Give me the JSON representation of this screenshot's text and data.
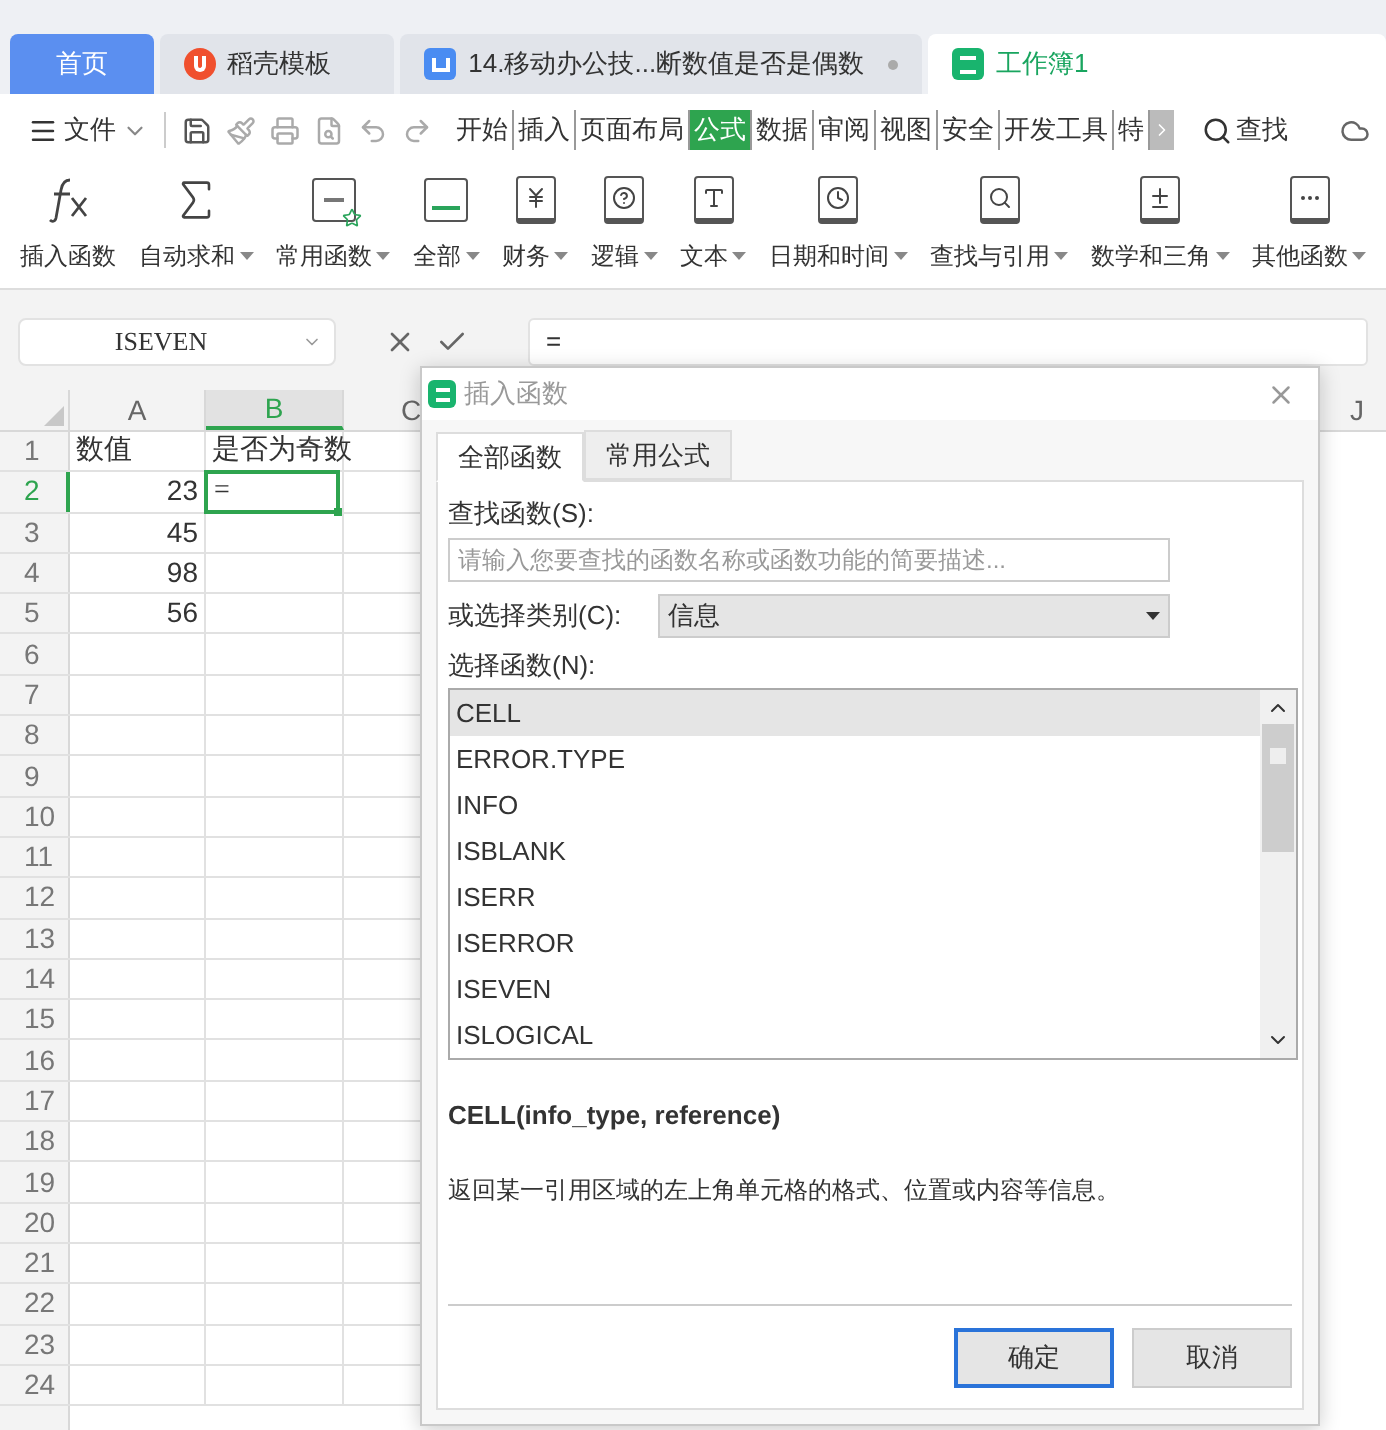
{
  "tabs": [
    {
      "label": "首页",
      "kind": "home",
      "selected": false,
      "modified": false
    },
    {
      "label": "稻壳模板",
      "kind": "docer",
      "selected": false,
      "modified": false
    },
    {
      "label": "14.移动办公技...断数值是否是偶数",
      "kind": "writer",
      "selected": false,
      "modified": true
    },
    {
      "label": "工作簿1",
      "kind": "sheet",
      "selected": true,
      "modified": false
    }
  ],
  "toolbar": {
    "file_menu": "文件",
    "menu_tabs": [
      {
        "label": "开始",
        "selected": false
      },
      {
        "label": "插入",
        "selected": false
      },
      {
        "label": "页面布局",
        "selected": false
      },
      {
        "label": "公式",
        "selected": true
      },
      {
        "label": "数据",
        "selected": false
      },
      {
        "label": "审阅",
        "selected": false
      },
      {
        "label": "视图",
        "selected": false
      },
      {
        "label": "安全",
        "selected": false
      },
      {
        "label": "开发工具",
        "selected": false
      },
      {
        "label": "特",
        "selected": false
      }
    ],
    "search": "查找"
  },
  "ribbon": [
    {
      "label": "插入函数",
      "has_menu": false
    },
    {
      "label": "自动求和",
      "has_menu": true
    },
    {
      "label": "常用函数",
      "has_menu": true
    },
    {
      "label": "全部",
      "has_menu": true
    },
    {
      "label": "财务",
      "has_menu": true
    },
    {
      "label": "逻辑",
      "has_menu": true
    },
    {
      "label": "文本",
      "has_menu": true
    },
    {
      "label": "日期和时间",
      "has_menu": true
    },
    {
      "label": "查找与引用",
      "has_menu": true
    },
    {
      "label": "数学和三角",
      "has_menu": true
    },
    {
      "label": "其他函数",
      "has_menu": true
    }
  ],
  "formula_bar": {
    "name_box": "ISEVEN",
    "formula": "="
  },
  "sheet": {
    "columns": [
      {
        "label": "A",
        "selected": false
      },
      {
        "label": "B",
        "selected": true
      },
      {
        "label": "C",
        "selected": false
      },
      {
        "label": "J",
        "selected": false
      }
    ],
    "rows": [
      {
        "header": "1",
        "selected": false,
        "cells": [
          {
            "value": "数值",
            "kind": "text",
            "active": false
          },
          {
            "value": "是否为奇数",
            "kind": "text",
            "active": false
          }
        ]
      },
      {
        "header": "2",
        "selected": true,
        "cells": [
          {
            "value": "23",
            "kind": "number",
            "active": false
          },
          {
            "value": "=",
            "kind": "text",
            "active": true
          }
        ]
      },
      {
        "header": "3",
        "selected": false,
        "cells": [
          {
            "value": "45",
            "kind": "number",
            "active": false
          }
        ]
      },
      {
        "header": "4",
        "selected": false,
        "cells": [
          {
            "value": "98",
            "kind": "number",
            "active": false
          }
        ]
      },
      {
        "header": "5",
        "selected": false,
        "cells": [
          {
            "value": "56",
            "kind": "number",
            "active": false
          }
        ]
      },
      {
        "header": "6",
        "selected": false
      },
      {
        "header": "7",
        "selected": false
      },
      {
        "header": "8",
        "selected": false
      },
      {
        "header": "9",
        "selected": false
      },
      {
        "header": "10",
        "selected": false
      },
      {
        "header": "11",
        "selected": false
      },
      {
        "header": "12",
        "selected": false
      },
      {
        "header": "13",
        "selected": false
      },
      {
        "header": "14",
        "selected": false
      },
      {
        "header": "15",
        "selected": false
      },
      {
        "header": "16",
        "selected": false
      },
      {
        "header": "17",
        "selected": false
      },
      {
        "header": "18",
        "selected": false
      },
      {
        "header": "19",
        "selected": false
      },
      {
        "header": "20",
        "selected": false
      },
      {
        "header": "21",
        "selected": false
      },
      {
        "header": "22",
        "selected": false
      },
      {
        "header": "23",
        "selected": false
      },
      {
        "header": "24",
        "selected": false
      }
    ]
  },
  "dialog": {
    "title": "插入函数",
    "tabs": [
      {
        "label": "全部函数",
        "selected": true
      },
      {
        "label": "常用公式",
        "selected": false
      }
    ],
    "search_label": "查找函数(S):",
    "search_placeholder": "请输入您要查找的函数名称或函数功能的简要描述...",
    "category_label": "或选择类别(C):",
    "category_value": "信息",
    "function_label": "选择函数(N):",
    "functions": [
      {
        "name": "CELL",
        "selected": true
      },
      {
        "name": "ERROR.TYPE",
        "selected": false
      },
      {
        "name": "INFO",
        "selected": false
      },
      {
        "name": "ISBLANK",
        "selected": false
      },
      {
        "name": "ISERR",
        "selected": false
      },
      {
        "name": "ISERROR",
        "selected": false
      },
      {
        "name": "ISEVEN",
        "selected": false
      },
      {
        "name": "ISLOGICAL",
        "selected": false
      }
    ],
    "signature": "CELL(info_type, reference)",
    "description": "返回某一引用区域的左上角单元格的格式、位置或内容等信息。",
    "buttons": [
      {
        "label": "确定",
        "default": true
      },
      {
        "label": "取消",
        "default": false
      }
    ]
  }
}
